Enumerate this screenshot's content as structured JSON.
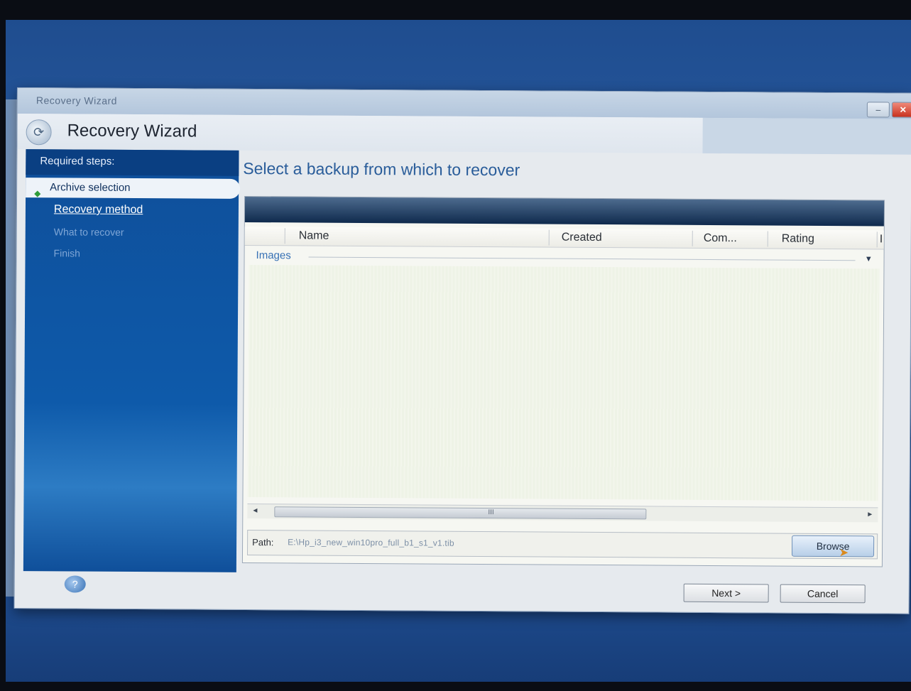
{
  "window": {
    "titlebar_text": "Recovery Wizard",
    "header_title": "Recovery Wizard",
    "minimize_glyph": "–",
    "close_glyph": "✕"
  },
  "sidebar": {
    "required_label": "Required steps:",
    "steps": [
      {
        "label": "Archive selection",
        "state": "current"
      },
      {
        "label": "Recovery method",
        "state": "link"
      },
      {
        "label": "What to recover",
        "state": "disabled"
      },
      {
        "label": "Finish",
        "state": "disabled"
      }
    ]
  },
  "main": {
    "heading": "Select a backup from which to recover",
    "columns": [
      "Name",
      "Created",
      "Com...",
      "Rating",
      "I"
    ],
    "group_label": "Images",
    "scroll_grip": "III",
    "path_label": "Path:",
    "path_value": "E:\\Hp_i3_new_win10pro_full_b1_s1_v1.tib",
    "browse_label": "Browse"
  },
  "footer": {
    "next_label": "Next >",
    "cancel_label": "Cancel"
  },
  "icons": {
    "logo": "recovery-logo-icon",
    "help": "help-icon",
    "group_toggle": "chevron-down-icon",
    "current_step": "green-arrow-icon"
  }
}
